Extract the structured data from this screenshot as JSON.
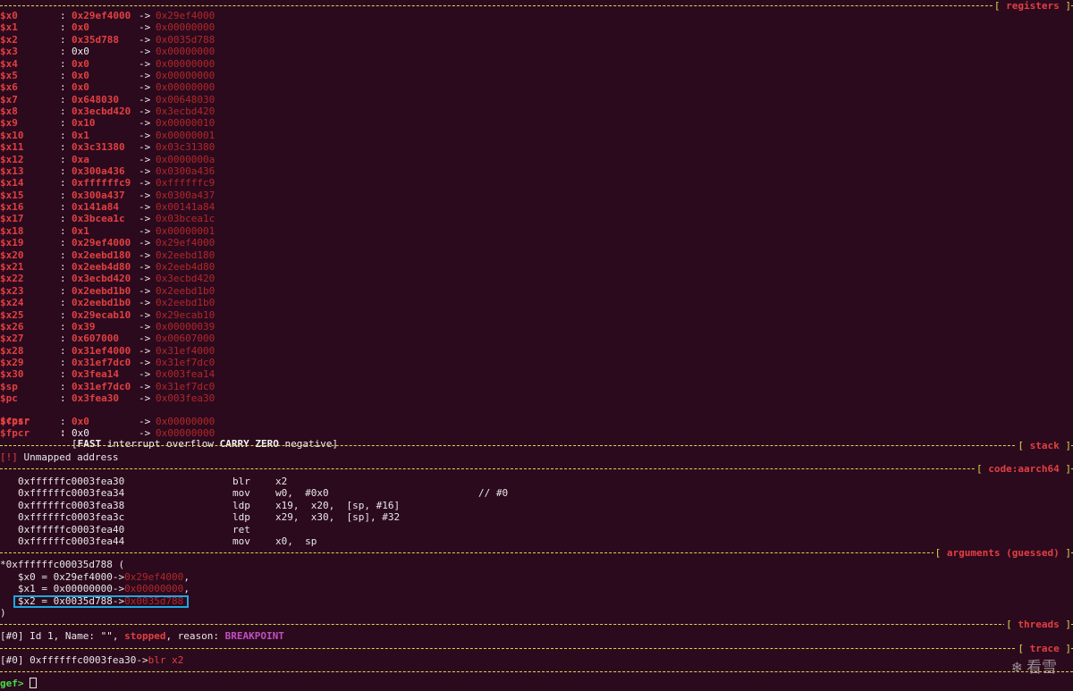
{
  "sections": {
    "registers": "registers",
    "stack": "stack",
    "code": "code:aarch64",
    "arguments": "arguments (guessed)",
    "threads": "threads",
    "trace": "trace"
  },
  "registers": [
    {
      "name": "$x0",
      "value": "0x29ef4000",
      "deref": "0x29ef4000",
      "bold": true
    },
    {
      "name": "$x1",
      "value": "0x0",
      "deref": "0x00000000",
      "bold": true
    },
    {
      "name": "$x2",
      "value": "0x35d788",
      "deref": "0x0035d788",
      "bold": true
    },
    {
      "name": "$x3",
      "value": "0x0",
      "deref": "0x00000000",
      "bold": false
    },
    {
      "name": "$x4",
      "value": "0x0",
      "deref": "0x00000000",
      "bold": true
    },
    {
      "name": "$x5",
      "value": "0x0",
      "deref": "0x00000000",
      "bold": true
    },
    {
      "name": "$x6",
      "value": "0x0",
      "deref": "0x00000000",
      "bold": true
    },
    {
      "name": "$x7",
      "value": "0x648030",
      "deref": "0x00648030",
      "bold": true
    },
    {
      "name": "$x8",
      "value": "0x3ecbd420",
      "deref": "0x3ecbd420",
      "bold": true
    },
    {
      "name": "$x9",
      "value": "0x10",
      "deref": "0x00000010",
      "bold": true
    },
    {
      "name": "$x10",
      "value": "0x1",
      "deref": "0x00000001",
      "bold": true
    },
    {
      "name": "$x11",
      "value": "0x3c31380",
      "deref": "0x03c31380",
      "bold": true
    },
    {
      "name": "$x12",
      "value": "0xa",
      "deref": "0x0000000a",
      "bold": true
    },
    {
      "name": "$x13",
      "value": "0x300a436",
      "deref": "0x0300a436",
      "bold": true
    },
    {
      "name": "$x14",
      "value": "0xffffffc9",
      "deref": "0xffffffc9",
      "bold": true
    },
    {
      "name": "$x15",
      "value": "0x300a437",
      "deref": "0x0300a437",
      "bold": true
    },
    {
      "name": "$x16",
      "value": "0x141a84",
      "deref": "0x00141a84",
      "bold": true
    },
    {
      "name": "$x17",
      "value": "0x3bcea1c",
      "deref": "0x03bcea1c",
      "bold": true
    },
    {
      "name": "$x18",
      "value": "0x1",
      "deref": "0x00000001",
      "bold": true
    },
    {
      "name": "$x19",
      "value": "0x29ef4000",
      "deref": "0x29ef4000",
      "bold": true
    },
    {
      "name": "$x20",
      "value": "0x2eebd180",
      "deref": "0x2eebd180",
      "bold": true
    },
    {
      "name": "$x21",
      "value": "0x2eeb4d80",
      "deref": "0x2eeb4d80",
      "bold": true
    },
    {
      "name": "$x22",
      "value": "0x3ecbd420",
      "deref": "0x3ecbd420",
      "bold": true
    },
    {
      "name": "$x23",
      "value": "0x2eebd1b0",
      "deref": "0x2eebd1b0",
      "bold": true
    },
    {
      "name": "$x24",
      "value": "0x2eebd1b0",
      "deref": "0x2eebd1b0",
      "bold": true
    },
    {
      "name": "$x25",
      "value": "0x29ecab10",
      "deref": "0x29ecab10",
      "bold": true
    },
    {
      "name": "$x26",
      "value": "0x39",
      "deref": "0x00000039",
      "bold": true
    },
    {
      "name": "$x27",
      "value": "0x607000",
      "deref": "0x00607000",
      "bold": true
    },
    {
      "name": "$x28",
      "value": "0x31ef4000",
      "deref": "0x31ef4000",
      "bold": true
    },
    {
      "name": "$x29",
      "value": "0x31ef7dc0",
      "deref": "0x31ef7dc0",
      "bold": true
    },
    {
      "name": "$x30",
      "value": "0x3fea14",
      "deref": "0x003fea14",
      "bold": true
    },
    {
      "name": "$sp",
      "value": "0x31ef7dc0",
      "deref": "0x31ef7dc0",
      "bold": true
    },
    {
      "name": "$pc",
      "value": "0x3fea30",
      "deref": "0x003fea30",
      "bold": true
    }
  ],
  "cpsr": {
    "name": "$cpsr",
    "open": "[",
    "fast": "FAST",
    "mid": " interrupt overflow ",
    "carry": "CARRY",
    "zero": "ZERO",
    "tail": " negative]"
  },
  "fpregs": [
    {
      "name": "$fpsr",
      "value": "0x0",
      "deref": "0x00000000",
      "bold": true
    },
    {
      "name": "$fpcr",
      "value": "0x0",
      "deref": "0x00000000",
      "bold": false
    }
  ],
  "stack": {
    "mark": "[!]",
    "text": " Unmapped address"
  },
  "code": [
    {
      "addr": "0xffffffc0003fea30",
      "mnemonic": "blr",
      "operands": "x2",
      "comment": ""
    },
    {
      "addr": "0xffffffc0003fea34",
      "mnemonic": "mov",
      "operands": "w0,  #0x0",
      "comment": "// #0"
    },
    {
      "addr": "0xffffffc0003fea38",
      "mnemonic": "ldp",
      "operands": "x19,  x20,  [sp, #16]",
      "comment": ""
    },
    {
      "addr": "0xffffffc0003fea3c",
      "mnemonic": "ldp",
      "operands": "x29,  x30,  [sp], #32",
      "comment": ""
    },
    {
      "addr": "0xffffffc0003fea40",
      "mnemonic": "ret",
      "operands": "",
      "comment": ""
    },
    {
      "addr": "0xffffffc0003fea44",
      "mnemonic": "mov",
      "operands": "x0,  sp",
      "comment": ""
    }
  ],
  "arguments": {
    "header": "*0xffffffc00035d788 (",
    "args": [
      {
        "text": "   $x0 = 0x29ef4000->",
        "deref": "0x29ef4000",
        "tail": ","
      },
      {
        "text": "   $x1 = 0x00000000->",
        "deref": "0x00000000",
        "tail": ","
      },
      {
        "text": "   $x2 = 0x0035d788->",
        "deref": "0x0035d788",
        "tail": ""
      }
    ],
    "footer": ")"
  },
  "threads": {
    "prefix": "[#0] Id 1, Name: \"\", ",
    "state": "stopped",
    "mid": ", reason: ",
    "reason": "BREAKPOINT"
  },
  "trace": {
    "prefix": "[#0] 0xffffffc0003fea30->",
    "call": "blr x2"
  },
  "prompt": {
    "text": "gef>"
  },
  "watermark": {
    "text": "看雪"
  },
  "colors": {
    "background": "#2c0a1e",
    "separator": "#d9d94a",
    "register": "#e04040",
    "highlight": "#1ea7e0"
  }
}
